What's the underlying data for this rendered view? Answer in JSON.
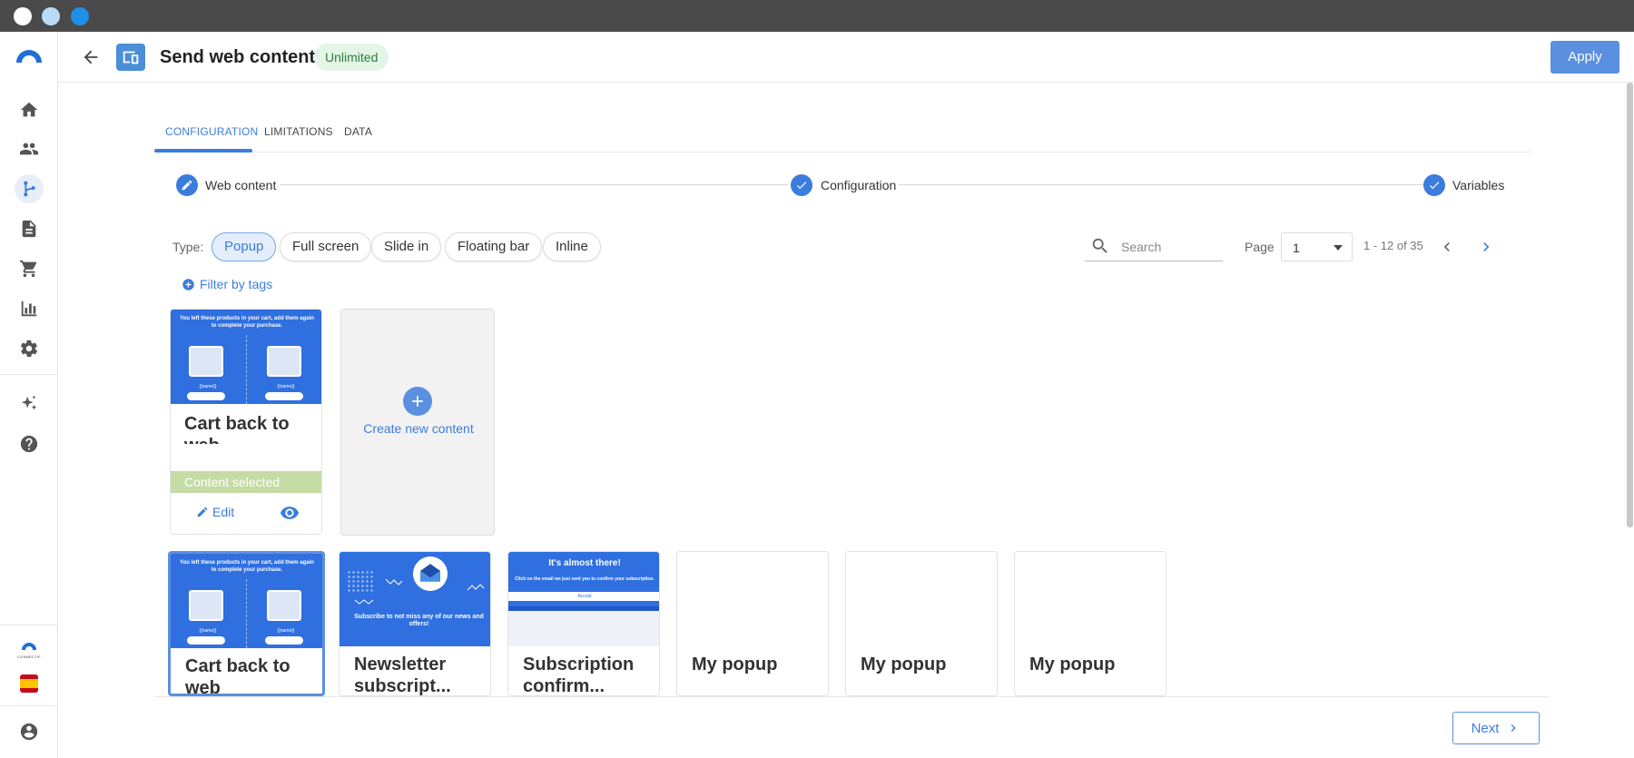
{
  "window": {
    "controls": [
      "close",
      "minimize",
      "maximize"
    ]
  },
  "sidebar": {
    "items": [
      {
        "icon": "home-icon"
      },
      {
        "icon": "people-icon"
      },
      {
        "icon": "flow-icon",
        "active": true
      },
      {
        "icon": "document-icon"
      },
      {
        "icon": "cart-icon"
      },
      {
        "icon": "bar-chart-icon"
      },
      {
        "icon": "gear-icon"
      },
      {
        "icon": "sparkle-icon"
      },
      {
        "icon": "help-icon"
      }
    ],
    "brand_small": "CONNECTIF",
    "language_flag": "ES"
  },
  "header": {
    "title": "Send web content",
    "badge": "Unlimited",
    "apply_label": "Apply"
  },
  "tabs": [
    {
      "label": "CONFIGURATION",
      "active": true
    },
    {
      "label": "LIMITATIONS"
    },
    {
      "label": "DATA"
    }
  ],
  "stepper": {
    "steps": [
      {
        "label": "Web content",
        "state": "editing"
      },
      {
        "label": "Configuration",
        "state": "done"
      },
      {
        "label": "Variables",
        "state": "done"
      }
    ]
  },
  "filters": {
    "type_label": "Type:",
    "types": [
      {
        "label": "Popup",
        "active": true
      },
      {
        "label": "Full screen"
      },
      {
        "label": "Slide in"
      },
      {
        "label": "Floating bar"
      },
      {
        "label": "Inline"
      }
    ],
    "search_placeholder": "Search",
    "page_label": "Page",
    "page_value": "1",
    "range_text": "1 - 12 of 35",
    "filter_by_tags": "Filter by tags"
  },
  "selected_card": {
    "thumb_text": "You left these products in your cart, add them again to complete your purchase.",
    "thumb_name": "{{name}}",
    "title": "Cart back to web",
    "selected_label": "Content selected",
    "edit_label": "Edit"
  },
  "create_card": {
    "label": "Create new content"
  },
  "content_cards": [
    {
      "title": "Cart back to web",
      "thumb": "cart"
    },
    {
      "title": "Newsletter subscript...",
      "thumb": "newsletter",
      "thumb_text": "Subscribe to not miss any of our news and offers!"
    },
    {
      "title": "Subscription confirm...",
      "thumb": "subscription",
      "thumb_title": "It's almost there!",
      "thumb_sub": "Click on the email we just sent you to confirm your subscription.",
      "thumb_button": "Accept"
    },
    {
      "title": "My popup",
      "thumb": "blank"
    },
    {
      "title": "My popup",
      "thumb": "blank"
    },
    {
      "title": "My popup",
      "thumb": "blank"
    }
  ],
  "footer": {
    "next_label": "Next"
  },
  "colors": {
    "accent": "#3b7ddd",
    "button": "#5b8fe0",
    "success_bg": "#e3f5e6",
    "selected_bar": "#c5dca5"
  }
}
